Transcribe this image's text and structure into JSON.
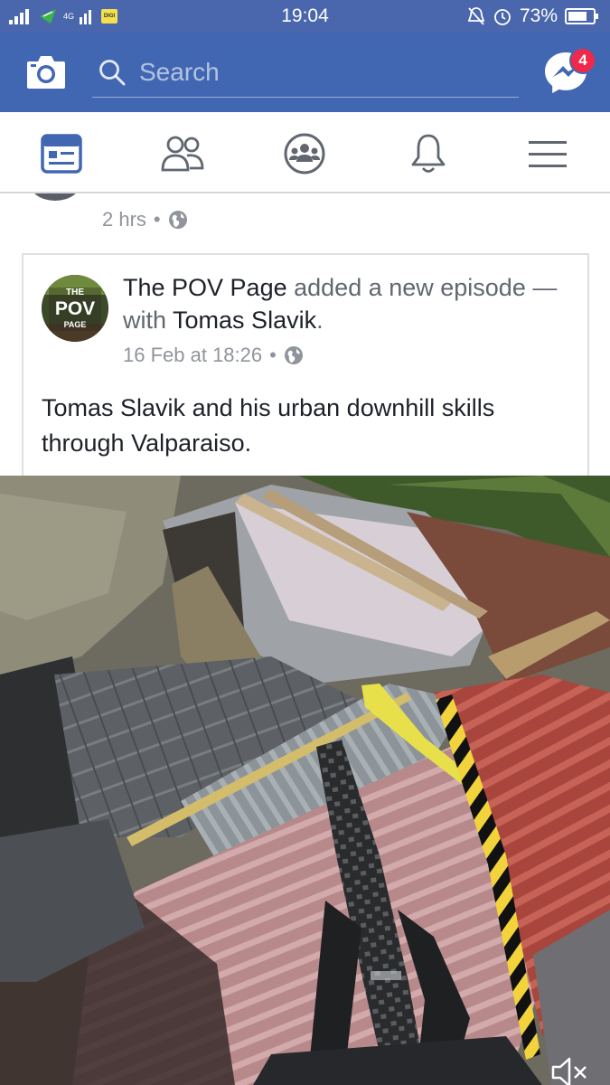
{
  "status_bar": {
    "network": "4G",
    "carrier_badge": "DIGI",
    "time": "19:04",
    "battery": "73%"
  },
  "app_bar": {
    "search_placeholder": "Search",
    "messenger_badge": "4",
    "icons": [
      "camera-icon",
      "search-icon",
      "messenger-icon"
    ]
  },
  "tabs": [
    {
      "name": "news-feed",
      "icon": "news-feed-icon",
      "active": true
    },
    {
      "name": "friends",
      "icon": "friends-icon",
      "active": false
    },
    {
      "name": "groups",
      "icon": "groups-icon",
      "active": false
    },
    {
      "name": "notifications",
      "icon": "bell-icon",
      "active": false
    },
    {
      "name": "menu",
      "icon": "hamburger-menu-icon",
      "active": false
    }
  ],
  "previous_post": {
    "time": "2 hrs",
    "separator": "•",
    "privacy_icon": "globe-icon"
  },
  "shared_post": {
    "avatar_text": {
      "line1": "THE",
      "line2": "POV",
      "line3": "PAGE"
    },
    "page_name": "The POV Page",
    "action_text": "added a new episode — with",
    "tagged_name": "Tomas Slavik",
    "period": ".",
    "date": "16 Feb at 18:26",
    "separator": "•",
    "privacy_icon": "globe-icon",
    "text_name": "Tomas Slavik",
    "text_rest": "and his urban downhill skills through Valparaiso."
  },
  "video": {
    "description": "POV of mountain bike on corrugated rooftops",
    "mute_icon": "speaker-muted-icon"
  },
  "colors": {
    "brand_blue": "#4267b2",
    "status_blue": "#4a67ad",
    "badge_red": "#f02849",
    "active_tab": "#4267b2",
    "inactive_tab": "#606770"
  }
}
